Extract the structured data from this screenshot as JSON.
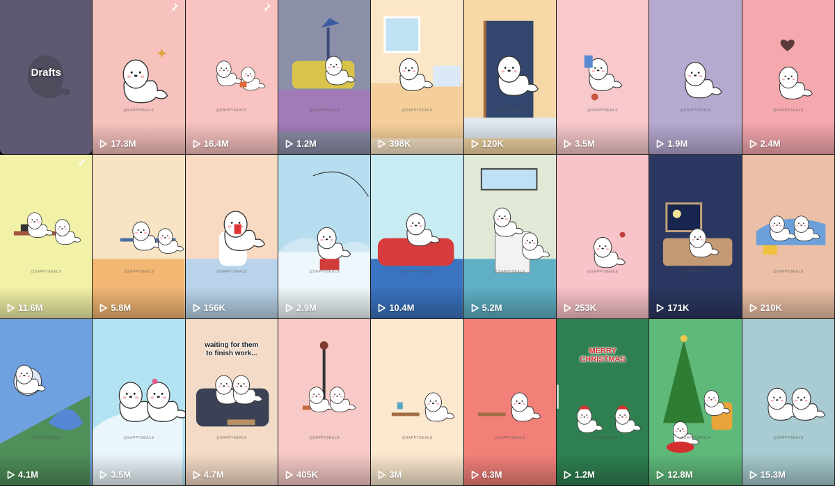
{
  "drafts": {
    "label": "Drafts"
  },
  "watermark": "@SAPPYSEALS",
  "christmas_text": [
    "MERRY",
    "CHRISTMAS"
  ],
  "work_caption": [
    "waiting for them",
    "to finish work..."
  ],
  "videos": [
    {
      "views": "17.3M",
      "bg": "#f7c2bd",
      "pinned": true,
      "scene": "seal-sparkle"
    },
    {
      "views": "16.4M",
      "bg": "#f8c3c0",
      "pinned": true,
      "scene": "two-seals-gift"
    },
    {
      "views": "1.2M",
      "bg": "#8b8fa8",
      "pinned": false,
      "scene": "couch-lamp"
    },
    {
      "views": "398K",
      "bg": "#fbe6c7",
      "pinned": false,
      "scene": "window-room"
    },
    {
      "views": "120K",
      "bg": "#f6d7a6",
      "pinned": false,
      "scene": "door-snow"
    },
    {
      "views": "3.5M",
      "bg": "#f7c9cc",
      "pinned": false,
      "scene": "seal-snacks"
    },
    {
      "views": "1.9M",
      "bg": "#b6a9d0",
      "pinned": false,
      "scene": "seal-simple"
    },
    {
      "views": "2.4M",
      "bg": "#f5a9ae",
      "pinned": false,
      "scene": "seal-heart"
    },
    {
      "views": "11.6M",
      "bg": "#f2f1a8",
      "pinned": true,
      "scene": "desk-two"
    },
    {
      "views": "5.8M",
      "bg": "#f8e4c5",
      "pinned": false,
      "scene": "office-room"
    },
    {
      "views": "156K",
      "bg": "#f8d9c1",
      "pinned": false,
      "scene": "bathroom"
    },
    {
      "views": "2.9M",
      "bg": "#b6def0",
      "pinned": false,
      "scene": "ice-fishing"
    },
    {
      "views": "10.4M",
      "bg": "#c9ecf3",
      "pinned": false,
      "scene": "red-sofa"
    },
    {
      "views": "5.2M",
      "bg": "#dfe9d6",
      "pinned": false,
      "scene": "laundry"
    },
    {
      "views": "253K",
      "bg": "#f8c3c9",
      "pinned": false,
      "scene": "seal-snack"
    },
    {
      "views": "171K",
      "bg": "#2b3760",
      "pinned": false,
      "scene": "night-bed"
    },
    {
      "views": "210K",
      "bg": "#ecc0a6",
      "pinned": false,
      "scene": "two-blanket"
    },
    {
      "views": "4.1M",
      "bg": "#6fa0df",
      "pinned": false,
      "scene": "sleeping-alarm"
    },
    {
      "views": "3.5M",
      "bg": "#b3e3f2",
      "pinned": false,
      "scene": "hug"
    },
    {
      "views": "4.7M",
      "bg": "#f4dbc7",
      "pinned": false,
      "scene": "waiting-work"
    },
    {
      "views": "405K",
      "bg": "#f7cac7",
      "pinned": false,
      "scene": "bench"
    },
    {
      "views": "3M",
      "bg": "#fbe8cf",
      "pinned": false,
      "scene": "tea-table"
    },
    {
      "views": "6.3M",
      "bg": "#f28079",
      "pinned": false,
      "scene": "small-table"
    },
    {
      "views": "1.2M",
      "bg": "#2f8051",
      "pinned": false,
      "scene": "merry-christmas"
    },
    {
      "views": "12.8M",
      "bg": "#5fb97b",
      "pinned": false,
      "scene": "christmas-tree"
    },
    {
      "views": "15.3M",
      "bg": "#a8ccd1",
      "pinned": false,
      "scene": "two-seals-phone"
    }
  ]
}
